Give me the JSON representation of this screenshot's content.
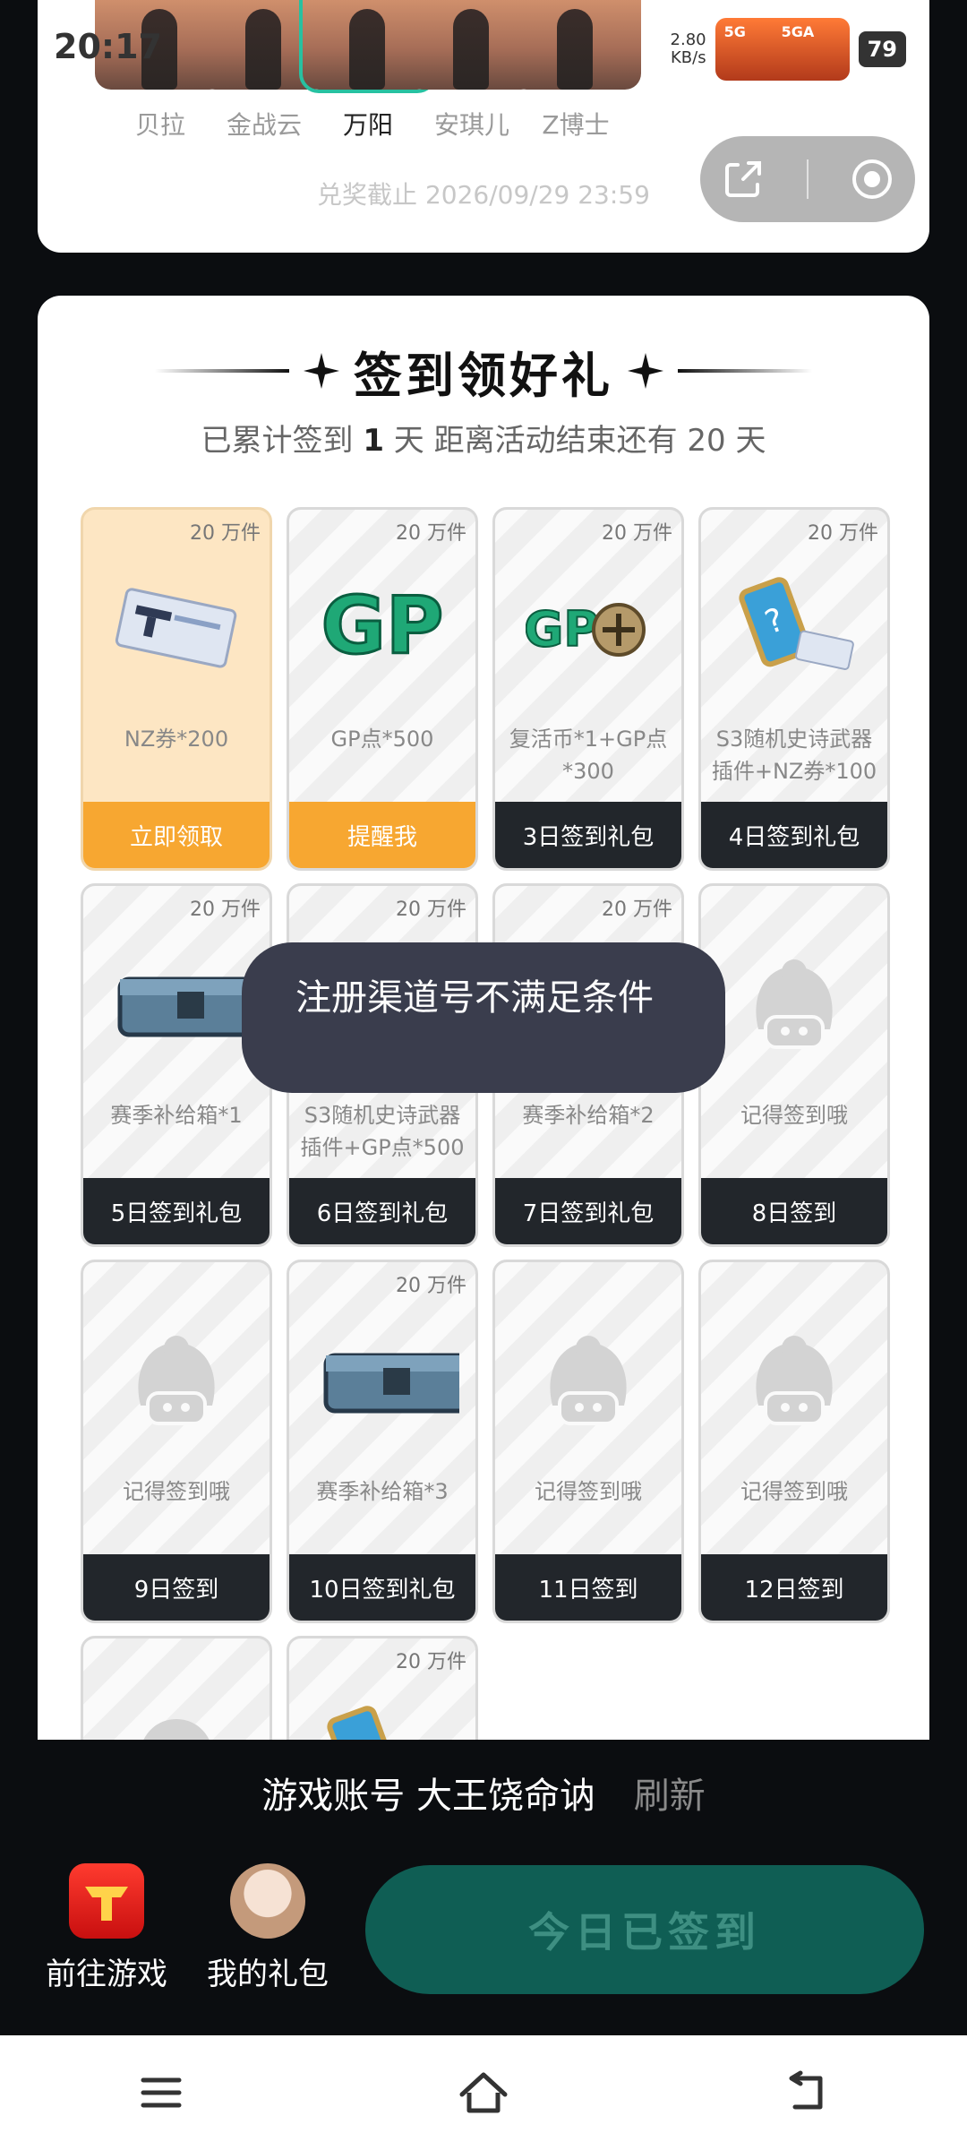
{
  "status": {
    "time": "20:17",
    "net_speed": "2.80",
    "net_unit": "KB/s",
    "sig1": "5G",
    "sig2": "5GA",
    "battery": "79"
  },
  "characters": [
    {
      "name": "贝拉"
    },
    {
      "name": "金战云"
    },
    {
      "name": "万阳"
    },
    {
      "name": "安琪儿"
    },
    {
      "name": "Z博士"
    }
  ],
  "deadline": "兑奖截止 2026/09/29 23:59",
  "signin": {
    "title": "签到领好礼",
    "subtitle_prefix": "已累计签到",
    "days_count": "1",
    "subtitle_mid": "天  距离活动结束还有 20 天",
    "cells": [
      {
        "qty": "20 万件",
        "desc": "NZ券*200",
        "btn": "立即领取",
        "btn_style": "orange",
        "icon": "ticket-icon"
      },
      {
        "qty": "20 万件",
        "desc": "GP点*500",
        "btn": "提醒我",
        "btn_style": "orange",
        "icon": "gp-icon"
      },
      {
        "qty": "20 万件",
        "desc": "复活币*1+GP点*300",
        "btn": "3日签到礼包",
        "btn_style": "dark",
        "icon": "gp-revive-icon"
      },
      {
        "qty": "20 万件",
        "desc": "S3随机史诗武器插件+NZ券*100",
        "btn": "4日签到礼包",
        "btn_style": "dark",
        "icon": "weapon-plugin-icon"
      },
      {
        "qty": "20 万件",
        "desc": "赛季补给箱*1",
        "btn": "5日签到礼包",
        "btn_style": "dark",
        "icon": "supply-box-icon"
      },
      {
        "qty": "20 万件",
        "desc": "S3随机史诗武器插件+GP点*500",
        "btn": "6日签到礼包",
        "btn_style": "dark",
        "icon": "weapon-plugin-icon"
      },
      {
        "qty": "20 万件",
        "desc": "赛季补给箱*2",
        "btn": "7日签到礼包",
        "btn_style": "dark",
        "icon": "supply-box-icon"
      },
      {
        "qty": "",
        "desc": "记得签到哦",
        "btn": "8日签到",
        "btn_style": "dark",
        "icon": "placeholder-avatar-icon"
      },
      {
        "qty": "",
        "desc": "记得签到哦",
        "btn": "9日签到",
        "btn_style": "dark",
        "icon": "placeholder-avatar-icon"
      },
      {
        "qty": "20 万件",
        "desc": "赛季补给箱*3",
        "btn": "10日签到礼包",
        "btn_style": "dark",
        "icon": "supply-box-icon"
      },
      {
        "qty": "",
        "desc": "记得签到哦",
        "btn": "11日签到",
        "btn_style": "dark",
        "icon": "placeholder-avatar-icon"
      },
      {
        "qty": "",
        "desc": "记得签到哦",
        "btn": "12日签到",
        "btn_style": "dark",
        "icon": "placeholder-avatar-icon"
      },
      {
        "qty": "",
        "desc": "",
        "btn": "",
        "btn_style": "dark",
        "icon": "placeholder-avatar-icon"
      },
      {
        "qty": "20 万件",
        "desc": "",
        "btn": "",
        "btn_style": "dark",
        "icon": "weapon-plugin-icon"
      }
    ]
  },
  "toast": "注册渠道号不满足条件",
  "bottom": {
    "account_label": "游戏账号 大王饶命讷",
    "refresh": "刷新",
    "goto_game": "前往游戏",
    "my_gifts": "我的礼包",
    "signin_button": "今日已签到"
  },
  "colors": {
    "accent_green": "#27c1a1",
    "orange": "#f7a731",
    "dark_button": "#22262b",
    "toast_bg": "#3a3d4d",
    "signin_btn_bg": "#0f5e54"
  }
}
